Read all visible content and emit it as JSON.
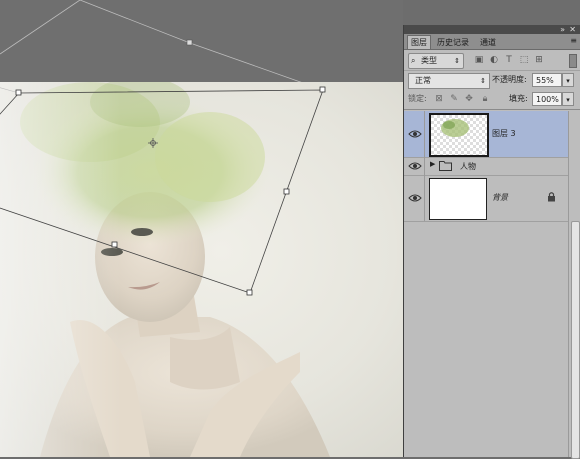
{
  "panel": {
    "tabs": [
      "图层",
      "历史记录",
      "通道"
    ],
    "active_tab": "图层",
    "window_icons": {
      "collapse": "collapse-icon",
      "close": "close-icon",
      "menu": "panel-menu-icon"
    },
    "filter": {
      "label": "类型",
      "icons": [
        "pixel-filter-icon",
        "adjustment-filter-icon",
        "type-filter-icon",
        "shape-filter-icon",
        "smart-object-filter-icon"
      ]
    },
    "blend_mode": "正常",
    "opacity_label": "不透明度:",
    "opacity_value": "55%",
    "lock_label": "锁定:",
    "lock_icons": [
      "lock-transparent-icon",
      "lock-paint-icon",
      "lock-position-icon",
      "lock-all-icon"
    ],
    "fill_label": "填充:",
    "fill_value": "100%",
    "layers": [
      {
        "name": "图层 3",
        "selected": true,
        "type": "pixel"
      },
      {
        "name": "人物",
        "selected": false,
        "type": "group"
      },
      {
        "name": "背景",
        "selected": false,
        "type": "background",
        "locked": true
      }
    ]
  },
  "colors": {
    "workspace": "#6f6f6f",
    "panel_bg": "#bdbdbd",
    "selected_layer": "#a7b6d6",
    "panel_header": "#4a4a4a"
  }
}
